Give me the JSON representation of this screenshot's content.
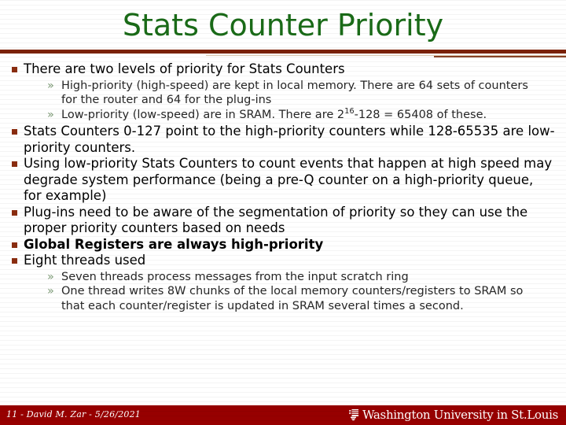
{
  "slide": {
    "title": "Stats Counter Priority",
    "title_color": "#1a6b18",
    "rule_color": "#7c2207",
    "bullet_square_color": "#8a2d10",
    "guillemet_color": "#7d9b76",
    "bullets": [
      {
        "text": "There are two levels of priority for Stats Counters",
        "bold": false,
        "subs": [
          "High-priority (high-speed) are kept in local memory. There are 64 sets of counters for the router and 64 for the plug-ins",
          "Low-priority (low-speed) are in SRAM. There are 2^16-128 = 65408 of these."
        ]
      },
      {
        "text": "Stats Counters 0-127 point to the high-priority counters while 128-65535 are low-priority counters.",
        "bold": false,
        "subs": []
      },
      {
        "text": "Using low-priority Stats Counters to count events that happen at high speed may degrade system performance (being a pre-Q counter on a high-priority queue, for example)",
        "bold": false,
        "subs": []
      },
      {
        "text": "Plug-ins need to be aware of the segmentation of priority so they can use the proper priority counters based on needs",
        "bold": false,
        "subs": []
      },
      {
        "text": "Global Registers are always high-priority",
        "bold": true,
        "subs": []
      },
      {
        "text": "Eight threads used",
        "bold": false,
        "subs": [
          "Seven threads process messages from the input scratch ring",
          "One thread writes 8W chunks of the local memory counters/registers to SRAM so that each counter/register is updated in SRAM several times a second."
        ]
      }
    ]
  },
  "sub_markers": {
    "guillemet": "»"
  },
  "low_priority_line": {
    "prefix": "Low-priority (low-speed) are in SRAM. There are 2",
    "exponent": "16",
    "suffix": "-128 = 65408 of these."
  },
  "footer": {
    "page_label": "11 - David M. Zar - 5/26/2021",
    "bar_color": "#970000",
    "university": "Washington University in St.Louis",
    "crest_icon": "wustl-crest-icon"
  }
}
